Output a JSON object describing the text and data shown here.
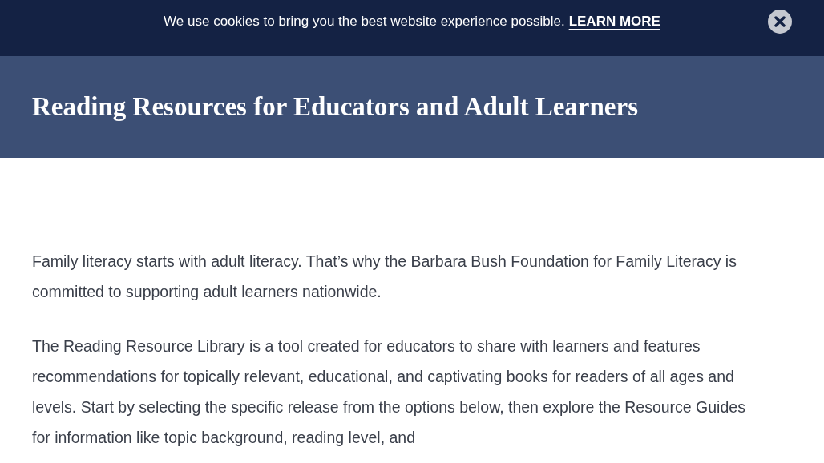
{
  "cookie_banner": {
    "message": "We use cookies to bring you the best website experience possible.",
    "link": "LEARN MORE"
  },
  "page_title": "Reading Resources for Educators and Adult Learners",
  "paragraphs": [
    "Family literacy starts with adult literacy. That’s why the Barbara Bush Foundation for Family Literacy is committed to supporting adult learners nationwide.",
    "The Reading Resource Library is a tool created for educators to share with learners and features recommendations for topically relevant, educational, and captivating books for readers of all ages and levels. Start by selecting the specific release from the options below, then explore the Resource Guides for information like topic background, reading level, and"
  ]
}
